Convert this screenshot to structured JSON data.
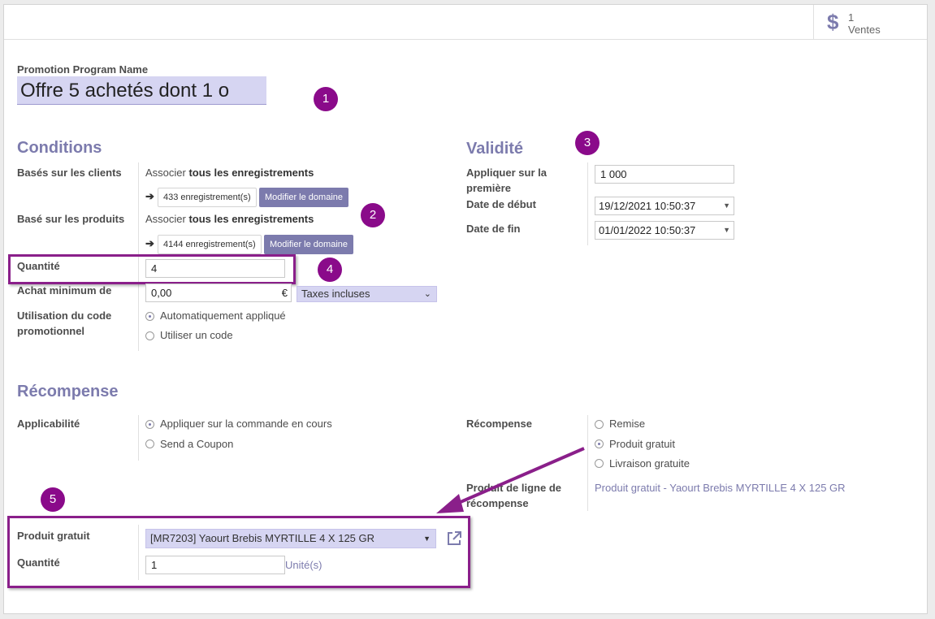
{
  "stat": {
    "count": "1",
    "label": "Ventes"
  },
  "header": {
    "name_label": "Promotion Program Name",
    "name_value": "Offre 5 achetés dont 1 o"
  },
  "conditions": {
    "title": "Conditions",
    "clients_label": "Basés sur les clients",
    "clients_prefix": "Associer ",
    "clients_bold": "tous les enregistrements",
    "clients_records": "433 enregistrement(s)",
    "modify_domain": "Modifier le domaine",
    "products_label": "Basé sur les produits",
    "products_prefix": "Associer ",
    "products_bold": "tous les enregistrements",
    "products_records": "4144 enregistrement(s)",
    "quantity_label": "Quantité",
    "quantity_value": "4",
    "min_purchase_label": "Achat minimum de",
    "min_purchase_value": "0,00",
    "currency": "€",
    "tax_mode": "Taxes incluses",
    "promo_code_label_1": "Utilisation du code",
    "promo_code_label_2": "promotionnel",
    "promo_auto": "Automatiquement appliqué",
    "promo_code": "Utiliser un code"
  },
  "validity": {
    "title": "Validité",
    "apply_label_1": "Appliquer sur la",
    "apply_label_2": "première",
    "apply_value": "1 000",
    "start_label": "Date de début",
    "start_value": "19/12/2021 10:50:37",
    "end_label": "Date de fin",
    "end_value": "01/01/2022 10:50:37"
  },
  "reward": {
    "title": "Récompense",
    "applicability_label": "Applicabilité",
    "apply_current": "Appliquer sur la commande en cours",
    "send_coupon": "Send a Coupon",
    "reward_label": "Récompense",
    "discount": "Remise",
    "free_product": "Produit gratuit",
    "free_shipping": "Livraison gratuite",
    "reward_line_label_1": "Produit de ligne de",
    "reward_line_label_2": "récompense",
    "reward_line_value": "Produit gratuit - Yaourt Brebis MYRTILLE 4 X 125 GR",
    "free_product_label": "Produit gratuit",
    "free_product_value": "[MR7203] Yaourt Brebis MYRTILLE 4 X 125 GR",
    "qty_label": "Quantité",
    "qty_value": "1",
    "unit": "Unité(s)"
  },
  "markers": [
    "1",
    "2",
    "3",
    "4",
    "5"
  ],
  "colors": {
    "accent": "#7c7bad",
    "annotation": "#8a0a8a"
  }
}
